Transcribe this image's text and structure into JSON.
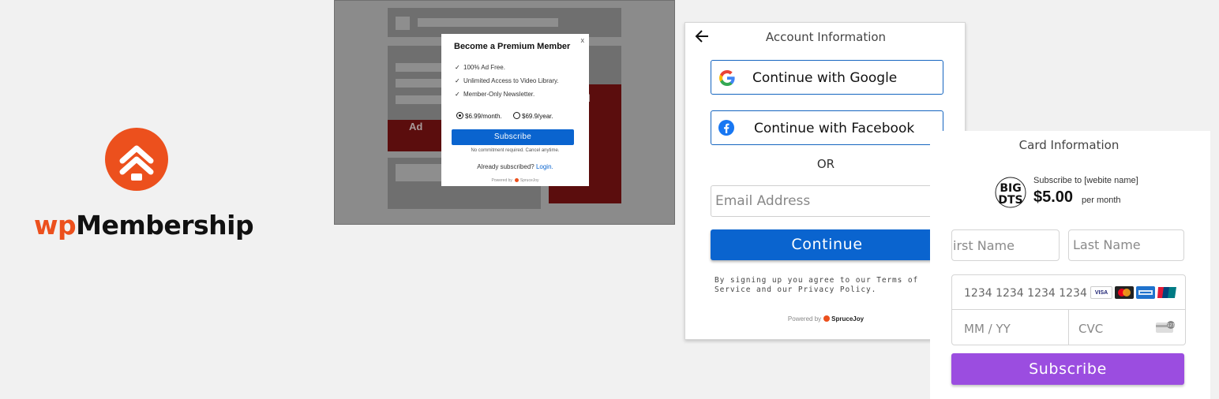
{
  "logo": {
    "wp": "wp",
    "rest": "Membership",
    "icon": "house-up-arrows-icon",
    "color": "#ec501d"
  },
  "mock_page": {
    "ad_label": "Ad",
    "ad_label_partial": "d"
  },
  "popup": {
    "close": "x",
    "title": "Become a Premium Member",
    "features": [
      "100% Ad Free.",
      "Unlimited Access to Video Library.",
      "Member-Only Newsletter."
    ],
    "plans": [
      {
        "label": "$6.99/month.",
        "selected": true
      },
      {
        "label": "$69.9/year.",
        "selected": false
      }
    ],
    "subscribe_label": "Subscribe",
    "note": "No commitment required. Cancel anytime.",
    "already": "Already subscribed?",
    "login": "Login.",
    "powered_by": "Powered by",
    "brand": "SpruceJoy"
  },
  "account": {
    "title": "Account Information",
    "google_label": "Continue with Google",
    "facebook_label": "Continue with Facebook",
    "or_label": "OR",
    "email_placeholder": "Email Address",
    "continue_label": "Continue",
    "terms": "By signing up you agree to our Terms of Service and our Privacy Policy.",
    "powered_by": "Powered by",
    "brand": "SpruceJoy",
    "primary_color": "#0a64cf"
  },
  "card": {
    "title": "Card Information",
    "subscribe_to": "Subscribe to [webite name]",
    "price": "$5.00",
    "period": "per month",
    "first_name_placeholder": "irst Name",
    "last_name_placeholder": "Last Name",
    "card_number_placeholder": "1234 1234 1234 1234",
    "expiry_placeholder": "MM / YY",
    "cvc_placeholder": "CVC",
    "brands": [
      "VISA",
      "Mastercard",
      "AMEX",
      "UnionPay"
    ],
    "subscribe_label": "Subscribe",
    "button_color": "#9b4de0"
  }
}
